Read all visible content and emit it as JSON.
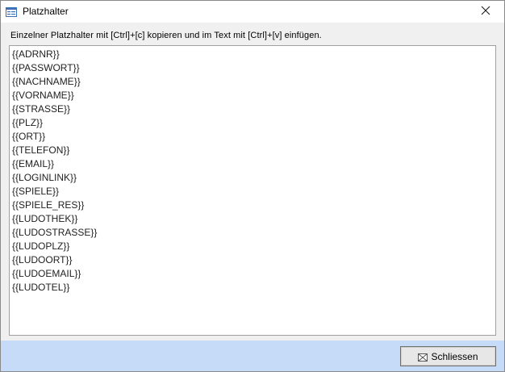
{
  "window": {
    "title": "Platzhalter",
    "close_glyph": "✕"
  },
  "instruction": "Einzelner Platzhalter mit [Ctrl]+[c] kopieren und im Text mit [Ctrl]+[v] einfügen.",
  "placeholders": [
    "{{ADRNR}}",
    "{{PASSWORT}}",
    "{{NACHNAME}}",
    "{{VORNAME}}",
    "{{STRASSE}}",
    "{{PLZ}}",
    "{{ORT}}",
    "{{TELEFON}}",
    "{{EMAIL}}",
    "{{LOGINLINK}}",
    "{{SPIELE}}",
    "{{SPIELE_RES}}",
    "{{LUDOTHEK}}",
    "{{LUDOSTRASSE}}",
    "{{LUDOPLZ}}",
    "{{LUDOORT}}",
    "{{LUDOEMAIL}}",
    "{{LUDOTEL}}"
  ],
  "footer": {
    "close_button_label": "Schliessen"
  },
  "colors": {
    "footer_bg": "#c6dbf7",
    "window_bg": "#f0f0f0"
  },
  "icons": {
    "title": "form-window-icon",
    "close": "close-icon",
    "button": "envelope-close-icon"
  }
}
